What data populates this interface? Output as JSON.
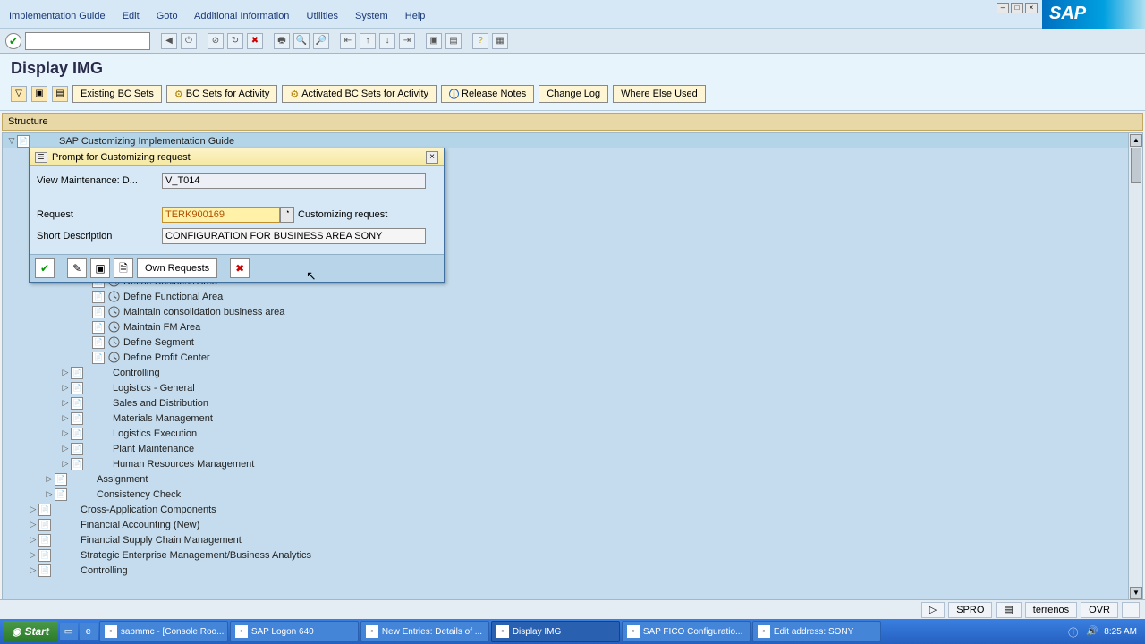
{
  "window": {
    "app": "SAP"
  },
  "menu": {
    "items": [
      "Implementation Guide",
      "Edit",
      "Goto",
      "Additional Information",
      "Utilities",
      "System",
      "Help"
    ]
  },
  "page": {
    "title": "Display IMG"
  },
  "app_toolbar": {
    "btn1": "Existing BC Sets",
    "btn2": "BC Sets for Activity",
    "btn3": "Activated BC Sets for Activity",
    "btn4": "Release Notes",
    "btn5": "Change Log",
    "btn6": "Where Else Used"
  },
  "structure_header": "Structure",
  "tree": {
    "root": "SAP Customizing Implementation Guide",
    "items": [
      {
        "indent": 96,
        "label": "Define Business Area",
        "act": true
      },
      {
        "indent": 96,
        "label": "Define Functional Area",
        "act": true
      },
      {
        "indent": 96,
        "label": "Maintain consolidation business area",
        "act": true
      },
      {
        "indent": 96,
        "label": "Maintain FM Area",
        "act": true
      },
      {
        "indent": 96,
        "label": "Define Segment",
        "act": true
      },
      {
        "indent": 96,
        "label": "Define Profit Center",
        "act": true
      },
      {
        "indent": 60,
        "label": "Controlling",
        "expand": "▷",
        "folder": true
      },
      {
        "indent": 60,
        "label": "Logistics - General",
        "expand": "▷",
        "folder": true
      },
      {
        "indent": 60,
        "label": "Sales and Distribution",
        "expand": "▷",
        "folder": true
      },
      {
        "indent": 60,
        "label": "Materials Management",
        "expand": "▷",
        "folder": true
      },
      {
        "indent": 60,
        "label": "Logistics Execution",
        "expand": "▷",
        "folder": true
      },
      {
        "indent": 60,
        "label": "Plant Maintenance",
        "expand": "▷",
        "folder": true
      },
      {
        "indent": 60,
        "label": "Human Resources Management",
        "expand": "▷",
        "folder": true
      },
      {
        "indent": 42,
        "label": "Assignment",
        "expand": "▷",
        "folder": true
      },
      {
        "indent": 42,
        "label": "Consistency Check",
        "expand": "▷",
        "folder": true
      },
      {
        "indent": 24,
        "label": "Cross-Application Components",
        "expand": "▷",
        "folder": true
      },
      {
        "indent": 24,
        "label": "Financial Accounting (New)",
        "expand": "▷",
        "folder": true
      },
      {
        "indent": 24,
        "label": "Financial Supply Chain Management",
        "expand": "▷",
        "folder": true
      },
      {
        "indent": 24,
        "label": "Strategic Enterprise Management/Business Analytics",
        "expand": "▷",
        "folder": true
      },
      {
        "indent": 24,
        "label": "Controlling",
        "expand": "▷",
        "folder": true
      }
    ]
  },
  "dialog": {
    "title": "Prompt for Customizing request",
    "view_label": "View Maintenance: D...",
    "view_value": "V_T014",
    "request_label": "Request",
    "request_value": "TERK900169",
    "request_desc": "Customizing request",
    "short_label": "Short Description",
    "short_value": "CONFIGURATION FOR BUSINESS AREA SONY",
    "own_requests": "Own Requests"
  },
  "status": {
    "tcode": "SPRO",
    "system": "terrenos",
    "mode": "OVR"
  },
  "taskbar": {
    "start": "Start",
    "tasks": [
      "sapmmc - [Console Roo...",
      "SAP Logon 640",
      "New Entries: Details of ...",
      "Display IMG",
      "SAP FICO Configuratio...",
      "Edit address:  SONY"
    ],
    "time": "8:25 AM"
  }
}
